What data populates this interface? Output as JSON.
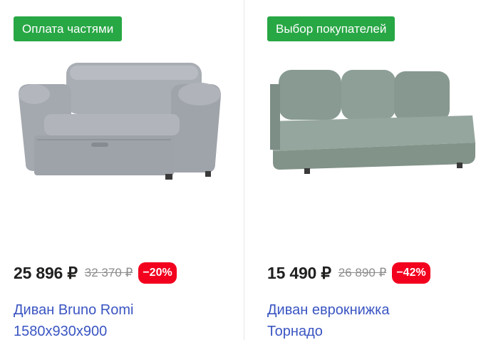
{
  "products": [
    {
      "badge": "Оплата частями",
      "price": "25 896 ₽",
      "old_price": "32 370 ₽",
      "discount": "−20%",
      "title_line1": "Диван Bruno Romi",
      "title_line2": "1580х930х900",
      "image": "gray-sofa-bed-with-rolled-arms"
    },
    {
      "badge": "Выбор покупателей",
      "price": "15 490 ₽",
      "old_price": "26 890 ₽",
      "discount": "−42%",
      "title_line1": "Диван еврокнижка",
      "title_line2": "Торнадо",
      "image": "sage-green-armless-sofa-three-cushions"
    }
  ],
  "colors": {
    "badge_green": "#28a745",
    "discount_red": "#f2001e",
    "link_blue": "#3a55c2",
    "price_text": "#21201f",
    "old_price_gray": "#8c8c8c"
  }
}
